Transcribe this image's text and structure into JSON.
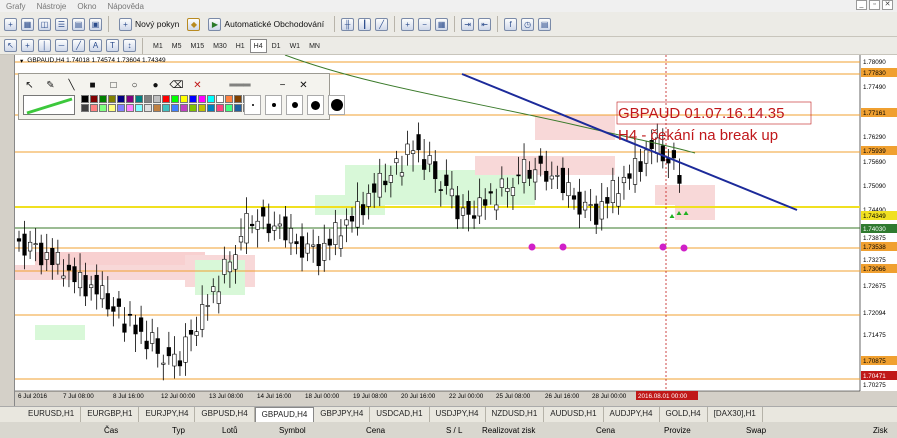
{
  "menu": [
    "Grafy",
    "Nástroje",
    "Okno",
    "Nápověda"
  ],
  "toolbar": {
    "new_order": "Nový pokyn",
    "auto_trading": "Automatické Obchodování"
  },
  "timeframes": [
    "M1",
    "M5",
    "M15",
    "M30",
    "H1",
    "H4",
    "D1",
    "W1",
    "MN"
  ],
  "active_timeframe": "H4",
  "chart": {
    "header": "GBPAUD,H4  1.74018 1.74574 1.73604 1.74349",
    "annotation_title": "GBPAUD 01.07.16.14.35",
    "annotation_note": "H4 - čekání na break up",
    "price_labels": [
      "1.78090",
      "1.77830",
      "1.77490",
      "1.77161",
      "1.76290",
      "1.75939",
      "1.75690",
      "1.75090",
      "1.74490",
      "1.74349",
      "1.74030",
      "1.73875",
      "1.73538",
      "1.73275",
      "1.73066",
      "1.72675",
      "1.72094",
      "1.71475",
      "1.70875",
      "1.70471",
      "1.70275"
    ],
    "date_labels": [
      "6 Jul 2016",
      "7 Jul 08:00",
      "8 Jul 16:00",
      "12 Jul 00:00",
      "13 Jul 08:00",
      "14 Jul 16:00",
      "18 Jul 00:00",
      "19 Jul 08:00",
      "20 Jul 16:00",
      "22 Jul 00:00",
      "25 Jul 08:00",
      "26 Jul 16:00",
      "28 Jul 00:00"
    ],
    "cursor_date": "2016.08.01 00:00"
  },
  "tabs": [
    "EURUSD,H1",
    "EURGBP,H1",
    "EURJPY,H4",
    "GBPUSD,H4",
    "GBPAUD,H4",
    "GBPJPY,H4",
    "USDCAD,H1",
    "USDJPY,H4",
    "NZDUSD,H1",
    "AUDUSD,H1",
    "AUDJPY,H4",
    "GOLD,H4",
    "[DAX30],H1"
  ],
  "active_tab": "GBPAUD,H4",
  "footer": [
    "Čas",
    "Typ",
    "Lotů",
    "Symbol",
    "Cena",
    "S / L",
    "Realizovat zisk",
    "Cena",
    "Provize",
    "Swap",
    "Zisk"
  ],
  "colors": {
    "chart_bg": "#ffffff",
    "trendline": "#1c2a9a",
    "annotation": "#c0181b",
    "level_orange": "#f0a030",
    "level_yellow": "#f0e020",
    "support_dot": "#d020c8",
    "ma_green": "#3a7a2a"
  }
}
